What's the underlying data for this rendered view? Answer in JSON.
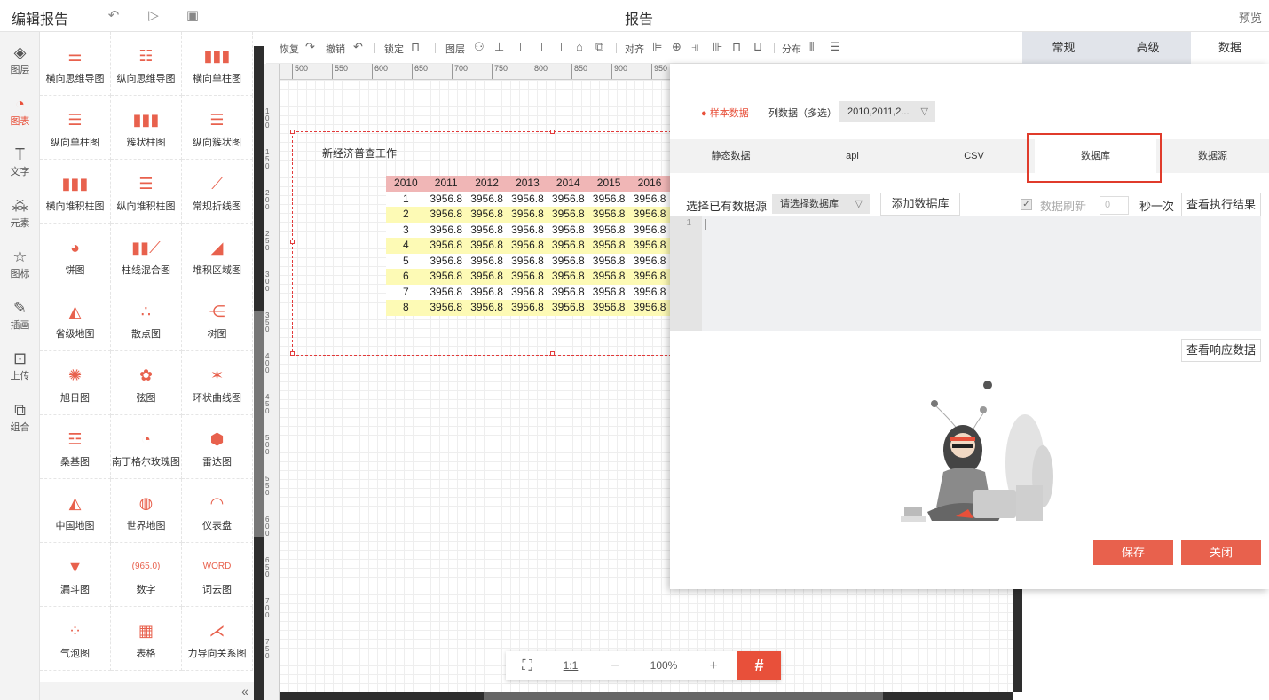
{
  "topbar": {
    "title": "编辑报告",
    "center": "报告",
    "preview": "预览"
  },
  "leftnav": [
    {
      "label": "图层",
      "icon": "layers-icon",
      "glyph": "◈"
    },
    {
      "label": "图表",
      "icon": "chart-icon",
      "glyph": "◔"
    },
    {
      "label": "文字",
      "icon": "text-icon",
      "glyph": "T"
    },
    {
      "label": "元素",
      "icon": "elements-icon",
      "glyph": "⁂"
    },
    {
      "label": "图标",
      "icon": "star-icon",
      "glyph": "☆"
    },
    {
      "label": "插画",
      "icon": "palette-icon",
      "glyph": "✎"
    },
    {
      "label": "上传",
      "icon": "upload-icon",
      "glyph": "⊡"
    },
    {
      "label": "组合",
      "icon": "group-icon",
      "glyph": "⧉"
    }
  ],
  "charts": [
    {
      "label": "横向思维导图",
      "icon": "horizontal-mindmap-icon",
      "glyph": "⚌"
    },
    {
      "label": "纵向思维导图",
      "icon": "vertical-mindmap-icon",
      "glyph": "☷"
    },
    {
      "label": "横向单柱图",
      "icon": "bar-chart-icon",
      "glyph": "▮▮▮"
    },
    {
      "label": "纵向单柱图",
      "icon": "hbar-chart-icon",
      "glyph": "☰"
    },
    {
      "label": "簇状柱图",
      "icon": "cluster-bar-icon",
      "glyph": "▮▮▮"
    },
    {
      "label": "纵向簇状图",
      "icon": "hcluster-bar-icon",
      "glyph": "☰"
    },
    {
      "label": "横向堆积柱图",
      "icon": "stacked-bar-icon",
      "glyph": "▮▮▮"
    },
    {
      "label": "纵向堆积柱图",
      "icon": "hstacked-bar-icon",
      "glyph": "☰"
    },
    {
      "label": "常规折线图",
      "icon": "line-chart-icon",
      "glyph": "⟋"
    },
    {
      "label": "饼图",
      "icon": "pie-chart-icon",
      "glyph": "◕"
    },
    {
      "label": "柱线混合图",
      "icon": "bar-line-icon",
      "glyph": "▮▮⟋"
    },
    {
      "label": "堆积区域图",
      "icon": "area-chart-icon",
      "glyph": "◢"
    },
    {
      "label": "省级地图",
      "icon": "province-map-icon",
      "glyph": "◭"
    },
    {
      "label": "散点图",
      "icon": "scatter-icon",
      "glyph": "∴"
    },
    {
      "label": "树图",
      "icon": "tree-icon",
      "glyph": "⋲"
    },
    {
      "label": "旭日图",
      "icon": "sunburst-icon",
      "glyph": "✺"
    },
    {
      "label": "弦图",
      "icon": "chord-icon",
      "glyph": "✿"
    },
    {
      "label": "环状曲线图",
      "icon": "ring-curve-icon",
      "glyph": "✶"
    },
    {
      "label": "桑基图",
      "icon": "sankey-icon",
      "glyph": "☲"
    },
    {
      "label": "南丁格尔玫瑰图",
      "icon": "rose-icon",
      "glyph": "◔"
    },
    {
      "label": "雷达图",
      "icon": "radar-icon",
      "glyph": "⬢"
    },
    {
      "label": "中国地图",
      "icon": "china-map-icon",
      "glyph": "◭"
    },
    {
      "label": "世界地图",
      "icon": "world-map-icon",
      "glyph": "◍"
    },
    {
      "label": "仪表盘",
      "icon": "gauge-icon",
      "glyph": "◠"
    },
    {
      "label": "漏斗图",
      "icon": "funnel-icon",
      "glyph": "▼"
    },
    {
      "label": "数字",
      "icon": "number-icon",
      "glyph": "(965.0)"
    },
    {
      "label": "词云图",
      "icon": "wordcloud-icon",
      "glyph": "WORD"
    },
    {
      "label": "气泡图",
      "icon": "bubble-icon",
      "glyph": "⁘"
    },
    {
      "label": "表格",
      "icon": "table-icon",
      "glyph": "▦"
    },
    {
      "label": "力导向关系图",
      "icon": "force-graph-icon",
      "glyph": "⋌"
    }
  ],
  "toolbar": {
    "redo": "恢复",
    "undo": "撤销",
    "lock": "锁定",
    "layer": "图层",
    "align": "对齐",
    "distribute": "分布"
  },
  "right_tabs": [
    "常规",
    "高级",
    "数据"
  ],
  "ruler": [
    "500",
    "550",
    "600",
    "650",
    "700",
    "750",
    "800",
    "850",
    "900",
    "950"
  ],
  "ruler_left": [
    "100",
    "150",
    "200",
    "250",
    "300",
    "350",
    "400",
    "450",
    "500",
    "550",
    "600",
    "650",
    "700",
    "750"
  ],
  "component": {
    "title": "新经济普查工作",
    "columns": [
      "2010",
      "2011",
      "2012",
      "2013",
      "2014",
      "2015",
      "2016"
    ],
    "rows": [
      [
        "1",
        "3956.8",
        "3956.8",
        "3956.8",
        "3956.8",
        "3956.8",
        "3956.8"
      ],
      [
        "2",
        "3956.8",
        "3956.8",
        "3956.8",
        "3956.8",
        "3956.8",
        "3956.8"
      ],
      [
        "3",
        "3956.8",
        "3956.8",
        "3956.8",
        "3956.8",
        "3956.8",
        "3956.8"
      ],
      [
        "4",
        "3956.8",
        "3956.8",
        "3956.8",
        "3956.8",
        "3956.8",
        "3956.8"
      ],
      [
        "5",
        "3956.8",
        "3956.8",
        "3956.8",
        "3956.8",
        "3956.8",
        "3956.8"
      ],
      [
        "6",
        "3956.8",
        "3956.8",
        "3956.8",
        "3956.8",
        "3956.8",
        "3956.8"
      ],
      [
        "7",
        "3956.8",
        "3956.8",
        "3956.8",
        "3956.8",
        "3956.8",
        "3956.8"
      ],
      [
        "8",
        "3956.8",
        "3956.8",
        "3956.8",
        "3956.8",
        "3956.8",
        "3956.8"
      ]
    ]
  },
  "zoom": {
    "fit": "⛶",
    "one_to_one": "1:1",
    "minus": "−",
    "level": "100%",
    "plus": "+",
    "grid": "#"
  },
  "dialog": {
    "sample_data": "样本数据",
    "column_data": "列数据（多选）",
    "column_select": "2010,2011,2...",
    "sub_tabs": [
      "静态数据",
      "api",
      "CSV",
      "数据库",
      "数据源"
    ],
    "choose_source": "选择已有数据源",
    "db_placeholder": "请选择数据库",
    "add_db": "添加数据库",
    "data_refresh": "数据刷新",
    "refresh_seconds": "0",
    "per_once": "秒一次",
    "view_result": "查看执行结果",
    "line_no": "1",
    "view_response": "查看响应数据",
    "save": "保存",
    "close": "关闭"
  }
}
